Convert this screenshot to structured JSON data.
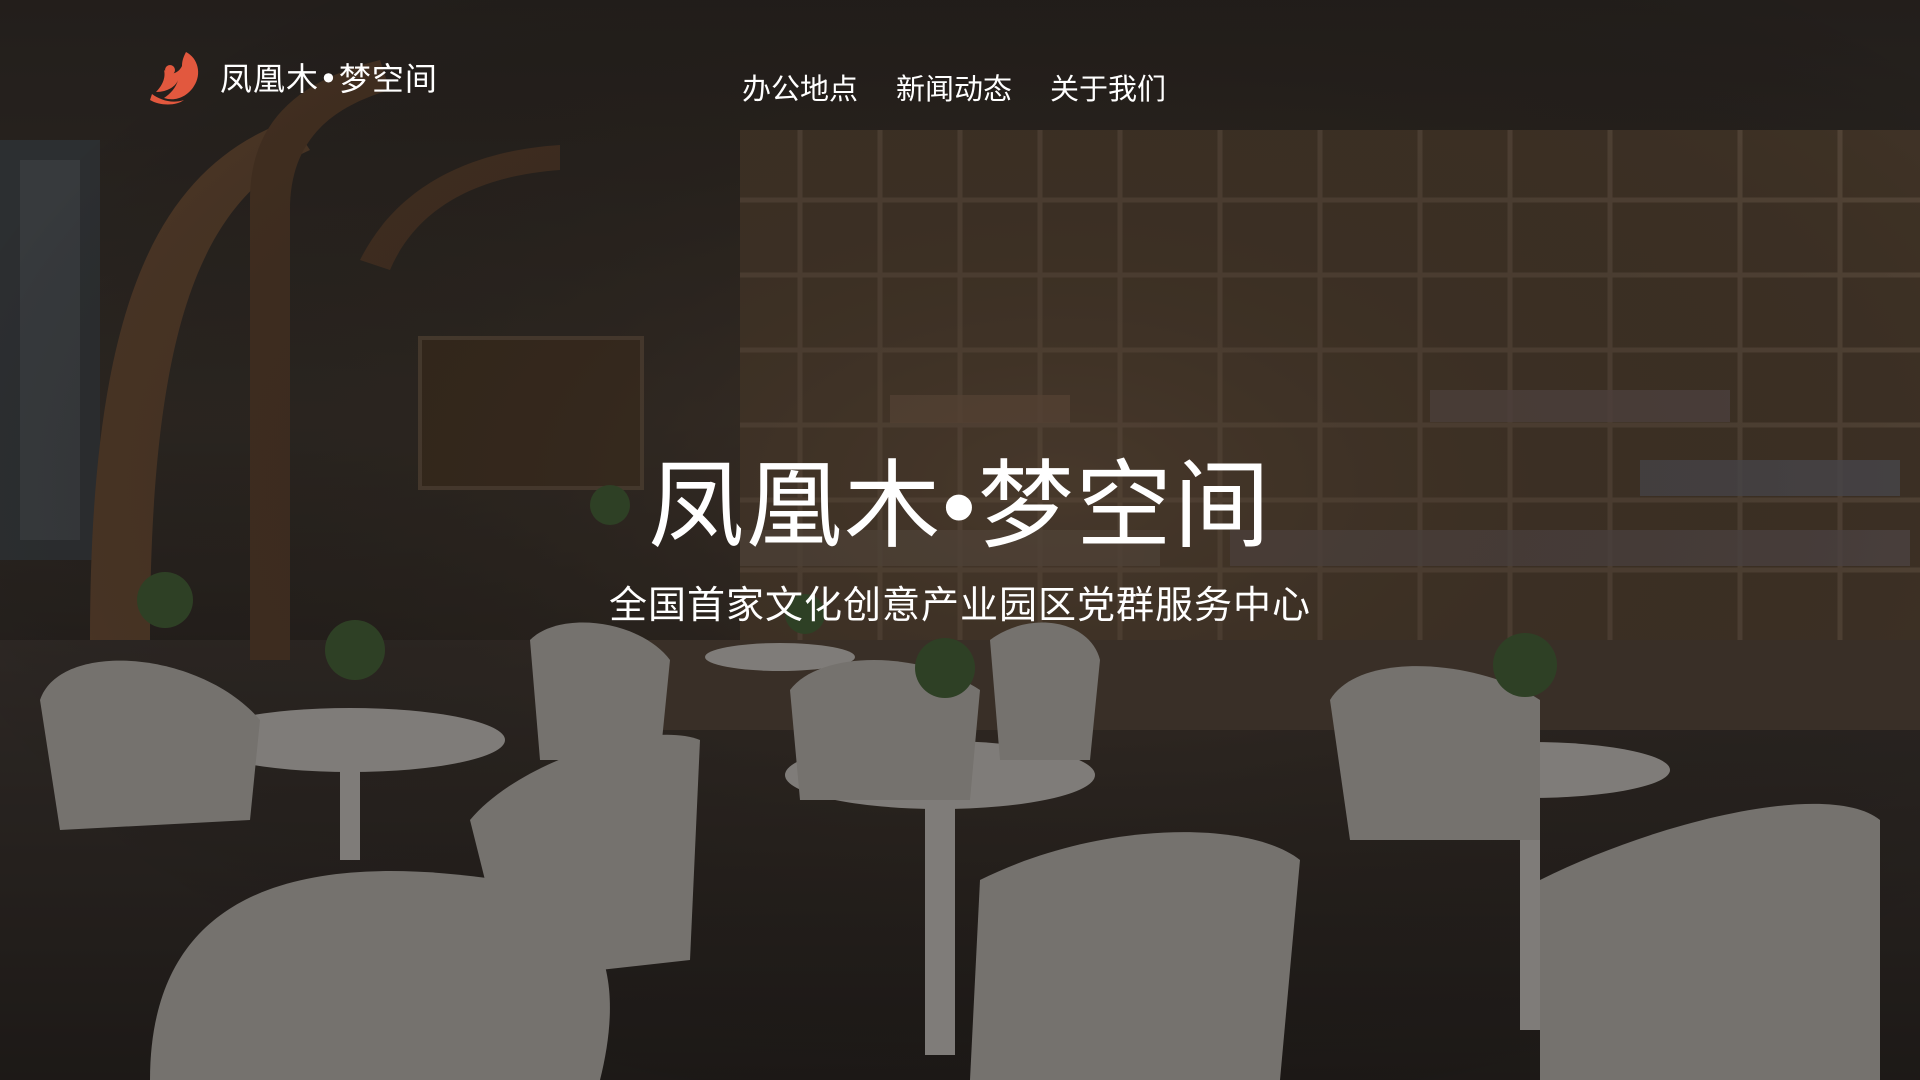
{
  "brand": {
    "name": "凤凰木•梦空间",
    "icon": "phoenix-flower-logo",
    "accent_color": "#e2583e"
  },
  "nav": {
    "items": [
      {
        "label": "办公地点"
      },
      {
        "label": "新闻动态"
      },
      {
        "label": "关于我们"
      }
    ]
  },
  "hero": {
    "title": "凤凰木•梦空间",
    "subtitle": "全国首家文化创意产业园区党群服务中心",
    "background": "library-cafe-photo"
  }
}
